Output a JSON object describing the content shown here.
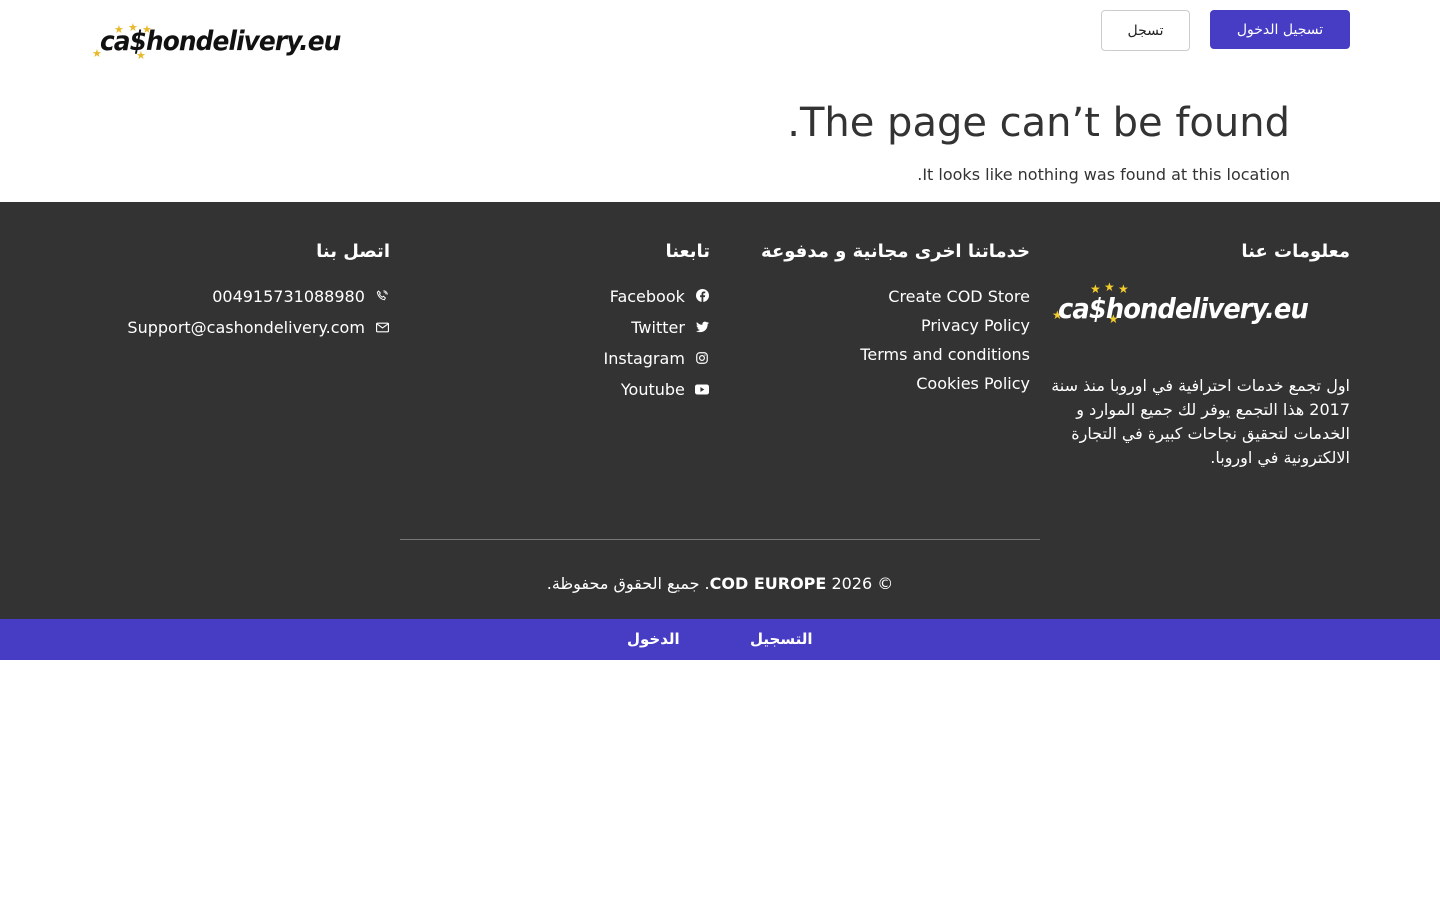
{
  "header": {
    "logo_text": "ca$hondelivery.eu",
    "login_button": "تسجيل الدخول",
    "register_button": "تسجل"
  },
  "not_found": {
    "title": "The page can’t be found.",
    "message": "It looks like nothing was found at this location."
  },
  "footer": {
    "about": {
      "heading": "معلومات عنا",
      "logo_text": "ca$hondelivery.eu",
      "text": "اول تجمع خدمات احترافية في اوروبا منذ سنة 2017 هذا التجمع يوفر لك جميع الموارد و الخدمات لتحقيق نجاحات كبيرة في التجارة الالكترونية في اوروبا."
    },
    "services": {
      "heading": "خدماتنا اخرى مجانية و مدفوعة",
      "links": [
        "Create COD Store",
        "Privacy Policy",
        "Terms and conditions",
        "Cookies Policy"
      ]
    },
    "follow": {
      "heading": "تابعنا",
      "links": [
        {
          "label": "Facebook",
          "icon": "facebook-icon"
        },
        {
          "label": "Twitter",
          "icon": "twitter-icon"
        },
        {
          "label": "Instagram",
          "icon": "instagram-icon"
        },
        {
          "label": "Youtube",
          "icon": "youtube-icon"
        }
      ]
    },
    "contact": {
      "heading": "اتصل بنا",
      "phone": "004915731088980",
      "email": "Support@cashondelivery.com"
    },
    "copyright": {
      "prefix": "© 2026 ",
      "brand": "COD EUROPE",
      "suffix": ". جميع الحقوق محفوظة."
    }
  },
  "bottom_bar": {
    "register": "التسجيل",
    "login": "الدخول"
  },
  "colors": {
    "accent": "#473dc4",
    "footer_bg": "#333333",
    "star": "#e8b92a"
  }
}
